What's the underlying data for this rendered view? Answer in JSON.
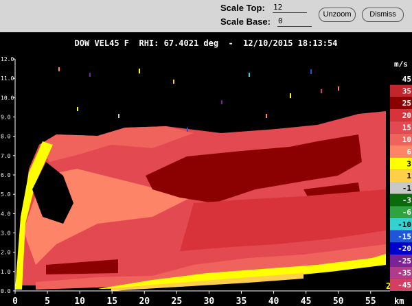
{
  "toolbar": {
    "scale_top_label": "Scale Top:",
    "scale_top_value": "12",
    "scale_base_label": "Scale Base:",
    "scale_base_value": "0",
    "unzoom_label": "Unzoom",
    "dismiss_label": "Dismiss"
  },
  "title": "DOW VEL45 F  RHI: 67.4021 deg  -  12/10/2015 18:13:54",
  "axes": {
    "x_ticks": [
      "0",
      "5",
      "10",
      "15",
      "20",
      "25",
      "30",
      "35",
      "40",
      "45",
      "50",
      "55"
    ],
    "x_unit": "km",
    "y_ticks": [
      "0.0",
      "1.0",
      "2.0",
      "3.0",
      "4.0",
      "5.0",
      "6.0",
      "7.0",
      "8.0",
      "9.0",
      "10.0",
      "11.0",
      "12.0"
    ],
    "x_range": [
      0,
      58
    ],
    "y_range": [
      0,
      12
    ]
  },
  "colorbar": {
    "unit": "m/s",
    "entries": [
      {
        "label": "45",
        "color": "#000000"
      },
      {
        "label": "35",
        "color": "#c0262b"
      },
      {
        "label": "25",
        "color": "#8b0000"
      },
      {
        "label": "20",
        "color": "#d8333a"
      },
      {
        "label": "15",
        "color": "#e34950"
      },
      {
        "label": "10",
        "color": "#f0625c"
      },
      {
        "label": "6",
        "color": "#fe8468"
      },
      {
        "label": "3",
        "color": "#ffff00"
      },
      {
        "label": "1",
        "color": "#ffcf4a"
      },
      {
        "label": "-1",
        "color": "#c8c8c8"
      },
      {
        "label": "-3",
        "color": "#0b6b0b"
      },
      {
        "label": "-6",
        "color": "#2ea340"
      },
      {
        "label": "-10",
        "color": "#35d0d0"
      },
      {
        "label": "-15",
        "color": "#1f55d8"
      },
      {
        "label": "-20",
        "color": "#0000cc"
      },
      {
        "label": "-25",
        "color": "#7b2296"
      },
      {
        "label": "-35",
        "color": "#b23a8a"
      },
      {
        "label": "-45",
        "color": "#d43e62"
      }
    ]
  },
  "corner_label": "2"
}
